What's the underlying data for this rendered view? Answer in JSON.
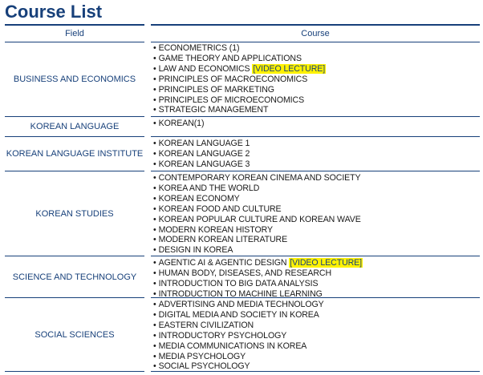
{
  "page": {
    "title": "Course List"
  },
  "table": {
    "headers": {
      "field": "Field",
      "course": "Course"
    },
    "bullet": "•",
    "rows": [
      {
        "field": "BUSINESS AND ECONOMICS",
        "courses": [
          {
            "name": "ECONOMETRICS (1)",
            "tag": ""
          },
          {
            "name": "GAME THEORY AND APPLICATIONS",
            "tag": ""
          },
          {
            "name": "LAW AND ECONOMICS ",
            "tag": "[VIDEO LECTURE]"
          },
          {
            "name": "PRINCIPLES OF MACROECONOMICS",
            "tag": ""
          },
          {
            "name": "PRINCIPLES OF MARKETING",
            "tag": ""
          },
          {
            "name": "PRINCIPLES OF MICROECONOMICS",
            "tag": ""
          },
          {
            "name": "STRATEGIC MANAGEMENT",
            "tag": ""
          }
        ]
      },
      {
        "field": "KOREAN LANGUAGE",
        "courses": [
          {
            "name": "KOREAN(1)",
            "tag": ""
          }
        ]
      },
      {
        "field": "KOREAN LANGUAGE INSTITUTE",
        "courses": [
          {
            "name": "KOREAN LANGUAGE 1",
            "tag": ""
          },
          {
            "name": "KOREAN LANGUAGE 2",
            "tag": ""
          },
          {
            "name": "KOREAN LANGUAGE 3",
            "tag": ""
          }
        ]
      },
      {
        "field": "KOREAN STUDIES",
        "courses": [
          {
            "name": "CONTEMPORARY KOREAN CINEMA AND SOCIETY",
            "tag": ""
          },
          {
            "name": "KOREA AND THE WORLD",
            "tag": ""
          },
          {
            "name": "KOREAN ECONOMY",
            "tag": ""
          },
          {
            "name": "KOREAN FOOD AND CULTURE",
            "tag": ""
          },
          {
            "name": "KOREAN POPULAR CULTURE AND KOREAN WAVE",
            "tag": ""
          },
          {
            "name": "MODERN KOREAN HISTORY",
            "tag": ""
          },
          {
            "name": "MODERN KOREAN LITERATURE",
            "tag": ""
          },
          {
            "name": "DESIGN IN KOREA",
            "tag": ""
          }
        ]
      },
      {
        "field": "SCIENCE AND TECHNOLOGY",
        "courses": [
          {
            "name": "AGENTIC AI & AGENTIC DESIGN ",
            "tag": "[VIDEO LECTURE]"
          },
          {
            "name": "HUMAN BODY, DISEASES, AND RESEARCH",
            "tag": ""
          },
          {
            "name": "INTRODUCTION TO BIG DATA ANALYSIS",
            "tag": ""
          },
          {
            "name": "INTRODUCTION TO MACHINE LEARNING",
            "tag": ""
          }
        ]
      },
      {
        "field": "SOCIAL SCIENCES",
        "courses": [
          {
            "name": "ADVERTISING AND MEDIA TECHNOLOGY",
            "tag": ""
          },
          {
            "name": "DIGITAL MEDIA AND SOCIETY IN KOREA",
            "tag": ""
          },
          {
            "name": "EASTERN CIVILIZATION",
            "tag": ""
          },
          {
            "name": "INTRODUCTORY PSYCHOLOGY",
            "tag": ""
          },
          {
            "name": "MEDIA COMMUNICATIONS IN KOREA",
            "tag": ""
          },
          {
            "name": "MEDIA PSYCHOLOGY",
            "tag": ""
          },
          {
            "name": "SOCIAL PSYCHOLOGY",
            "tag": ""
          }
        ]
      }
    ]
  },
  "colors": {
    "heading": "#17407a",
    "rule": "#17407a",
    "highlight": "#fff200",
    "text": "#1a1a1a"
  }
}
